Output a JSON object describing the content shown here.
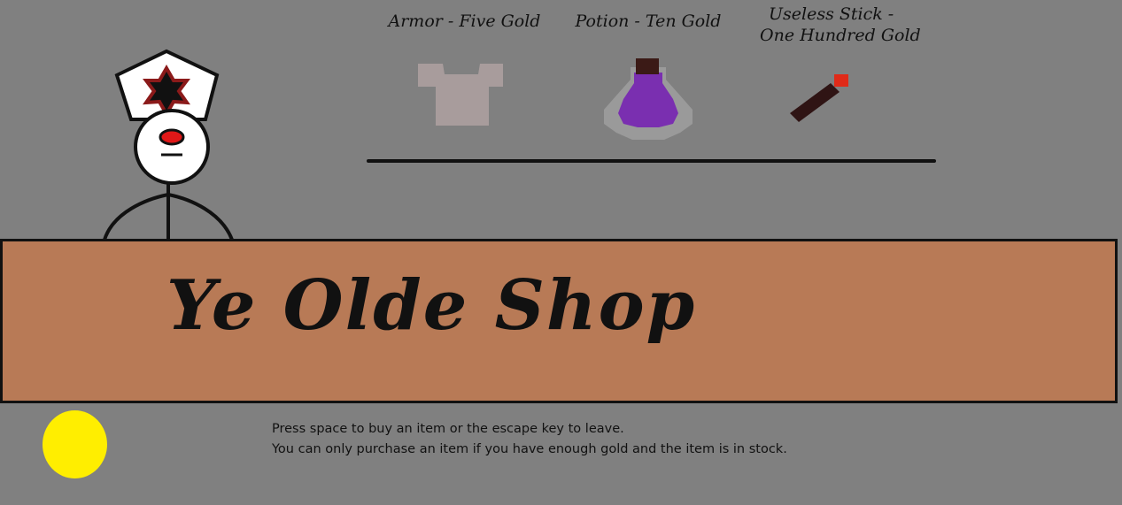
{
  "shop": {
    "title": "Ye Olde Shop"
  },
  "items": [
    {
      "label": "Armor - Five Gold",
      "icon": "armor-icon"
    },
    {
      "label": "Potion - Ten Gold",
      "icon": "potion-icon"
    },
    {
      "label_line1": "Useless Stick -",
      "label_line2": "One Hundred Gold",
      "icon": "stick-icon"
    }
  ],
  "instructions": {
    "line1": "Press space to buy an item or the escape key to leave.",
    "line2": "You can only purchase an item if you have enough gold and the item is in stock."
  },
  "colors": {
    "background": "#808080",
    "counter": "#b87a56",
    "coin": "#ffee00",
    "potion": "#7a2fb0",
    "armor": "#a89c9c"
  }
}
